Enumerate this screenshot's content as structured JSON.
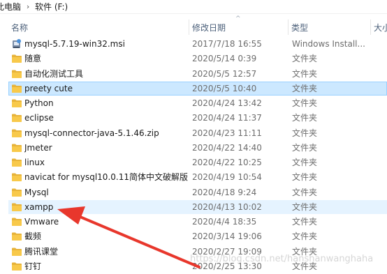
{
  "breadcrumb": {
    "items": [
      "此电脑",
      "软件 (F:)"
    ],
    "separator": "›"
  },
  "columns": {
    "name": "名称",
    "date": "修改日期",
    "type": "类型",
    "size": "大小"
  },
  "files": [
    {
      "name": "mysql-5.7.19-win32.msi",
      "date": "2017/7/18 16:55",
      "type": "Windows Install...",
      "icon": "msi-installer-icon"
    },
    {
      "name": "随意",
      "date": "2020/5/14 0:39",
      "type": "文件夹",
      "icon": "folder-icon"
    },
    {
      "name": "自动化测试工具",
      "date": "2020/5/5 12:57",
      "type": "文件夹",
      "icon": "folder-icon"
    },
    {
      "name": "preety cute",
      "date": "2020/5/5 10:40",
      "type": "文件夹",
      "icon": "folder-icon"
    },
    {
      "name": "Python",
      "date": "2020/4/24 13:42",
      "type": "文件夹",
      "icon": "folder-icon"
    },
    {
      "name": "eclipse",
      "date": "2020/4/24 11:37",
      "type": "文件夹",
      "icon": "folder-icon"
    },
    {
      "name": "mysql-connector-java-5.1.46.zip",
      "date": "2020/4/23 11:11",
      "type": "文件夹",
      "icon": "folder-icon"
    },
    {
      "name": "Jmeter",
      "date": "2020/4/22 14:40",
      "type": "文件夹",
      "icon": "folder-icon"
    },
    {
      "name": "linux",
      "date": "2020/4/22 10:25",
      "type": "文件夹",
      "icon": "folder-icon"
    },
    {
      "name": "navicat for mysql10.0.11简体中文破解版",
      "date": "2020/4/19 10:54",
      "type": "文件夹",
      "icon": "folder-icon"
    },
    {
      "name": "Mysql",
      "date": "2020/4/18 9:24",
      "type": "文件夹",
      "icon": "folder-icon"
    },
    {
      "name": "xampp",
      "date": "2020/4/13 10:02",
      "type": "文件夹",
      "icon": "folder-icon"
    },
    {
      "name": "Vmware",
      "date": "2020/4/4 18:35",
      "type": "文件夹",
      "icon": "folder-icon"
    },
    {
      "name": "截频",
      "date": "2020/3/14 19:06",
      "type": "文件夹",
      "icon": "folder-icon"
    },
    {
      "name": "腾讯课堂",
      "date": "2020/2/27 19:09",
      "type": "文件夹",
      "icon": "folder-icon"
    },
    {
      "name": "钉钉",
      "date": "2020/2/25 13:30",
      "type": "文件夹",
      "icon": "folder-icon"
    }
  ],
  "selected_index": 3,
  "highlighted_index": 11,
  "watermark": "https://blog.csdn.net/hanshanwanghaha",
  "colors": {
    "folder": "#f8c94a",
    "selection": "#cce8ff",
    "hover": "#e5f3ff",
    "arrow": "#e8372c"
  }
}
